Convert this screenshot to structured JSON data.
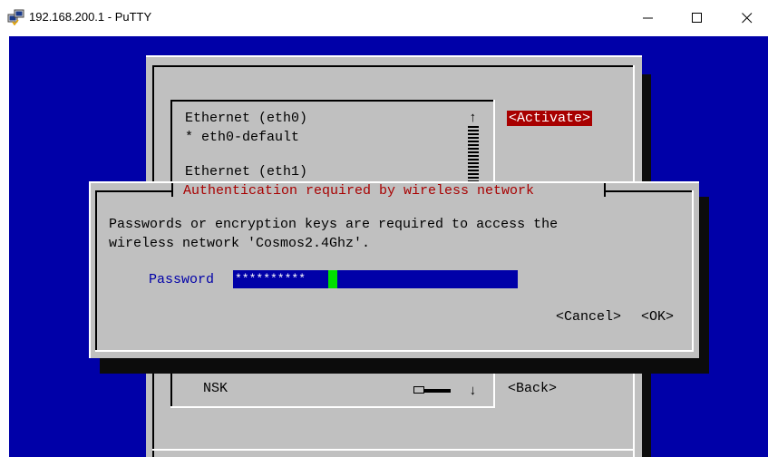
{
  "window": {
    "title": "192.168.200.1 - PuTTY",
    "icon": "putty-computers-icon",
    "controls": {
      "minimize": "minimize-icon",
      "maximize": "maximize-icon",
      "close": "close-icon"
    }
  },
  "background_dialog": {
    "connections": [
      {
        "label": "Ethernet (eth0)"
      },
      {
        "label": "* eth0-default"
      },
      {
        "label": "Ethernet (eth1)"
      },
      {
        "label": "NSK"
      }
    ],
    "scroll_up_arrow": "↑",
    "scroll_down_arrow": "↓",
    "activate_button": "<Activate>",
    "back_button": "<Back>"
  },
  "auth_dialog": {
    "title": "Authentication required by wireless network",
    "message_line1": "Passwords or encryption keys are required to access the",
    "message_line2": "wireless network 'Cosmos2.4Ghz'.",
    "password_label": "Password",
    "password_value": "**********",
    "cancel_button": "<Cancel>",
    "ok_button": "<OK>"
  },
  "colors": {
    "terminal_bg": "#0000a8",
    "dialog_bg": "#c0c0c0",
    "title_red": "#a80000",
    "cursor_green": "#00e000"
  }
}
